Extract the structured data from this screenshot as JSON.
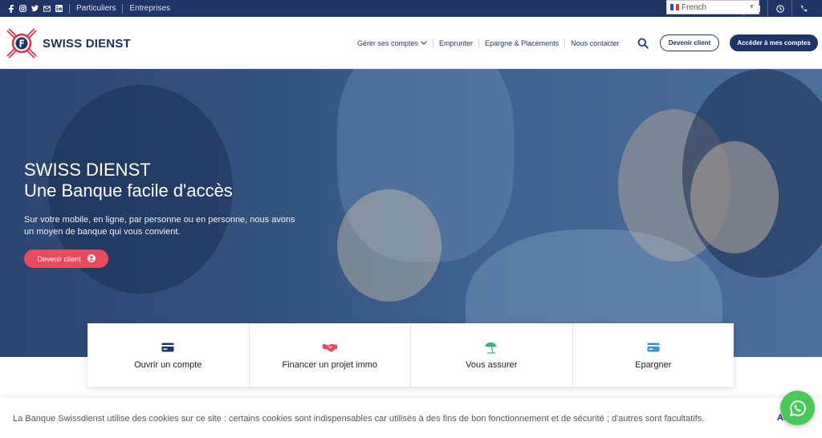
{
  "topbar": {
    "social_icons": [
      "facebook-icon",
      "instagram-icon",
      "twitter-icon",
      "mail-icon",
      "linkedin-icon"
    ],
    "links": [
      "Particuliers",
      "Entreprises"
    ],
    "language": "French",
    "right_icons": [
      "mail-icon",
      "clock-icon",
      "phone-icon"
    ]
  },
  "header": {
    "brand": "SWISS DIENST",
    "nav": [
      "Gérer ses comptes",
      "Emprunter",
      "Epargne & Placements",
      "Nous contacter"
    ],
    "cta_outline": "Devenir client",
    "cta_solid": "Accéder à mes comptes"
  },
  "hero": {
    "title_line1": "SWISS DIENST",
    "title_line2": "Une Banque facile d'accès",
    "subtitle": "Sur votre mobile, en ligne, par personne ou en personne, nous avons un moyen de banque qui vous convient.",
    "button": "Devenir client"
  },
  "cards": [
    {
      "label": "Ouvrir un compte",
      "icon": "credit-card-icon",
      "color": "#1f3566"
    },
    {
      "label": "Financer un projet immo",
      "icon": "handshake-icon",
      "color": "#e94a5e"
    },
    {
      "label": "Vous assurer",
      "icon": "beach-umbrella-icon",
      "color": "#3bb08f"
    },
    {
      "label": "Epargner",
      "icon": "card-icon",
      "color": "#3a8fc7"
    }
  ],
  "cookie": {
    "text": "La Banque Swissdienst utilise des cookies sur ce site : certains cookies sont indispensables car utilisés à des fins de bon fonctionnement et de sécurité ; d'autres sont facultatifs.",
    "accept": "Ac"
  },
  "colors": {
    "navy": "#1f3566",
    "accent_red": "#e94a5e",
    "whatsapp_green": "#4ac959"
  }
}
